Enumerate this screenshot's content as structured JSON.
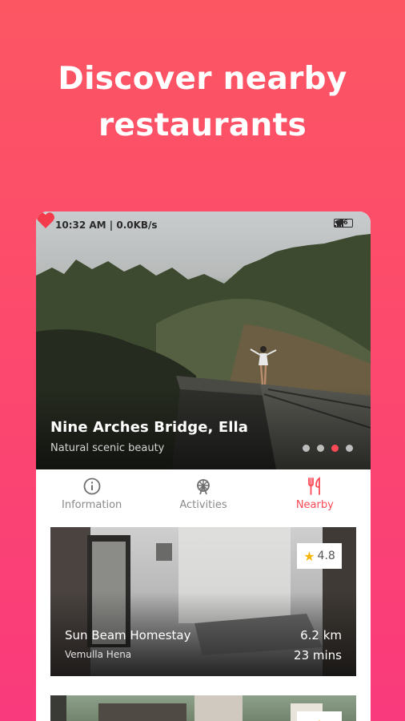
{
  "headline": {
    "line1": "Discover nearby",
    "line2": "restaurants"
  },
  "status_bar": {
    "time": "10:32 AM | 0.0KB/s",
    "battery": "26"
  },
  "place": {
    "title": "Nine Arches Bridge, Ella",
    "subtitle": "Natural scenic beauty",
    "slides": 4,
    "active_slide": 3
  },
  "tabs": [
    {
      "label": "Information",
      "icon": "info-icon",
      "active": false
    },
    {
      "label": "Activities",
      "icon": "ferris-wheel-icon",
      "active": false
    },
    {
      "label": "Nearby",
      "icon": "fork-knife-icon",
      "active": true
    }
  ],
  "restaurants": [
    {
      "name": "Sun Beam Homestay",
      "location": "Vemulla Hena",
      "rating": "4.8",
      "distance": "6.2 km",
      "time": "23 mins"
    }
  ],
  "colors": {
    "accent": "#fb4a55",
    "background_top": "#fc5663",
    "background_bottom": "#f93a7c",
    "star": "#f7b500"
  }
}
